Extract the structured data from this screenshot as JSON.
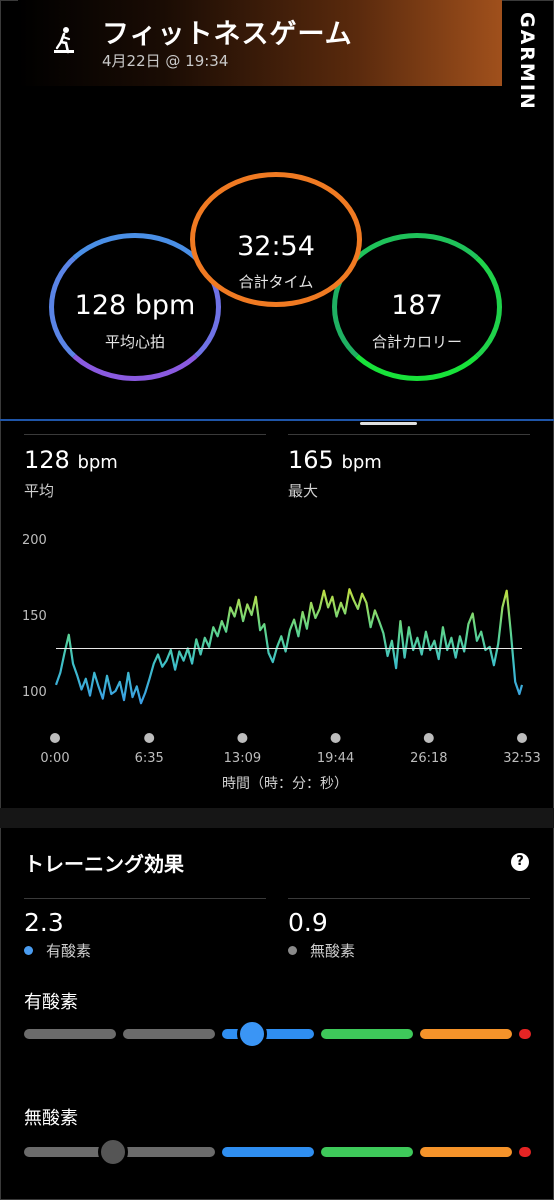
{
  "header": {
    "title": "フィットネスゲーム",
    "date": "4月22日 @ 19:34",
    "brand": "GARMIN",
    "activity_icon": "fitness-equipment-icon"
  },
  "summary": {
    "avg_hr": {
      "value": "128 bpm",
      "label": "平均心拍"
    },
    "total_time": {
      "value": "32:54",
      "label": "合計タイム"
    },
    "total_calories": {
      "value": "187",
      "label": "合計カロリー"
    }
  },
  "heart_rate": {
    "avg": {
      "value": "128",
      "unit": "bpm",
      "label": "平均"
    },
    "max": {
      "value": "165",
      "unit": "bpm",
      "label": "最大"
    }
  },
  "chart_data": {
    "type": "line",
    "title": "",
    "xlabel": "時間（時：分：秒）",
    "ylabel": "",
    "x_ticks": [
      "0:00",
      "6:35",
      "13:09",
      "19:44",
      "26:18",
      "32:53"
    ],
    "y_ticks": [
      "200",
      "150",
      "100"
    ],
    "ylim": [
      90,
      205
    ],
    "average_line": 128,
    "series": [
      {
        "x": [
          0.0,
          0.3,
          0.6,
          0.9,
          1.2,
          1.5,
          1.8,
          2.1,
          2.4,
          2.7,
          3.0,
          3.3,
          3.6,
          3.9,
          4.2,
          4.5,
          4.8,
          5.1,
          5.4,
          5.7,
          6.0,
          6.3,
          6.6,
          6.9,
          7.2,
          7.5,
          7.8,
          8.1,
          8.4,
          8.7,
          9.0,
          9.3,
          9.6,
          9.9,
          10.2,
          10.5,
          10.8,
          11.1,
          11.4,
          11.7,
          12.0,
          12.3,
          12.6,
          12.9,
          13.2,
          13.5,
          13.8,
          14.1,
          14.4,
          14.7,
          15.0,
          15.3,
          15.6,
          15.9,
          16.2,
          16.5,
          16.8,
          17.1,
          17.4,
          17.7,
          18.0,
          18.3,
          18.6,
          18.9,
          19.2,
          19.5,
          19.8,
          20.1,
          20.4,
          20.7,
          21.0,
          21.3,
          21.6,
          21.9,
          22.2,
          22.5,
          22.8,
          23.1,
          23.4,
          23.7,
          24.0,
          24.3,
          24.6,
          24.9,
          25.2,
          25.5,
          25.8,
          26.1,
          26.4,
          26.7,
          27.0,
          27.3,
          27.6,
          27.9,
          28.2,
          28.5,
          28.8,
          29.1,
          29.4,
          29.7,
          30.0,
          30.3,
          30.6,
          30.9,
          31.2,
          31.5,
          31.8,
          32.1,
          32.4,
          32.7,
          32.88
        ],
        "y": [
          104,
          112,
          125,
          137,
          118,
          110,
          101,
          108,
          97,
          112,
          103,
          95,
          110,
          98,
          100,
          106,
          94,
          112,
          96,
          103,
          92,
          99,
          108,
          118,
          124,
          116,
          120,
          127,
          114,
          126,
          120,
          128,
          118,
          134,
          124,
          135,
          129,
          142,
          136,
          146,
          139,
          155,
          149,
          160,
          146,
          157,
          150,
          162,
          140,
          144,
          125,
          119,
          129,
          136,
          126,
          140,
          147,
          136,
          152,
          141,
          158,
          148,
          154,
          166,
          155,
          162,
          149,
          158,
          151,
          167,
          160,
          154,
          164,
          158,
          142,
          153,
          146,
          138,
          123,
          133,
          115,
          146,
          122,
          142,
          127,
          135,
          124,
          139,
          127,
          133,
          121,
          142,
          127,
          135,
          122,
          136,
          126,
          144,
          151,
          133,
          139,
          127,
          129,
          117,
          131,
          155,
          166,
          138,
          106,
          98,
          104
        ],
        "name": ""
      }
    ]
  }
}
